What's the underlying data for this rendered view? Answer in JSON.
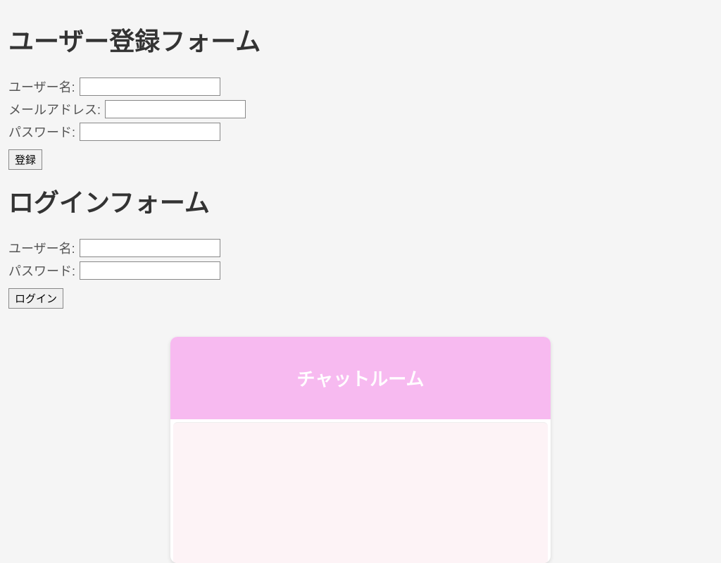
{
  "registration": {
    "heading": "ユーザー登録フォーム",
    "username_label": "ユーザー名:",
    "username_value": "",
    "email_label": "メールアドレス:",
    "email_value": "",
    "password_label": "パスワード:",
    "password_value": "",
    "submit_label": "登録"
  },
  "login": {
    "heading": "ログインフォーム",
    "username_label": "ユーザー名:",
    "username_value": "",
    "password_label": "パスワード:",
    "password_value": "",
    "submit_label": "ログイン"
  },
  "chat": {
    "header_title": "チャットルーム"
  }
}
